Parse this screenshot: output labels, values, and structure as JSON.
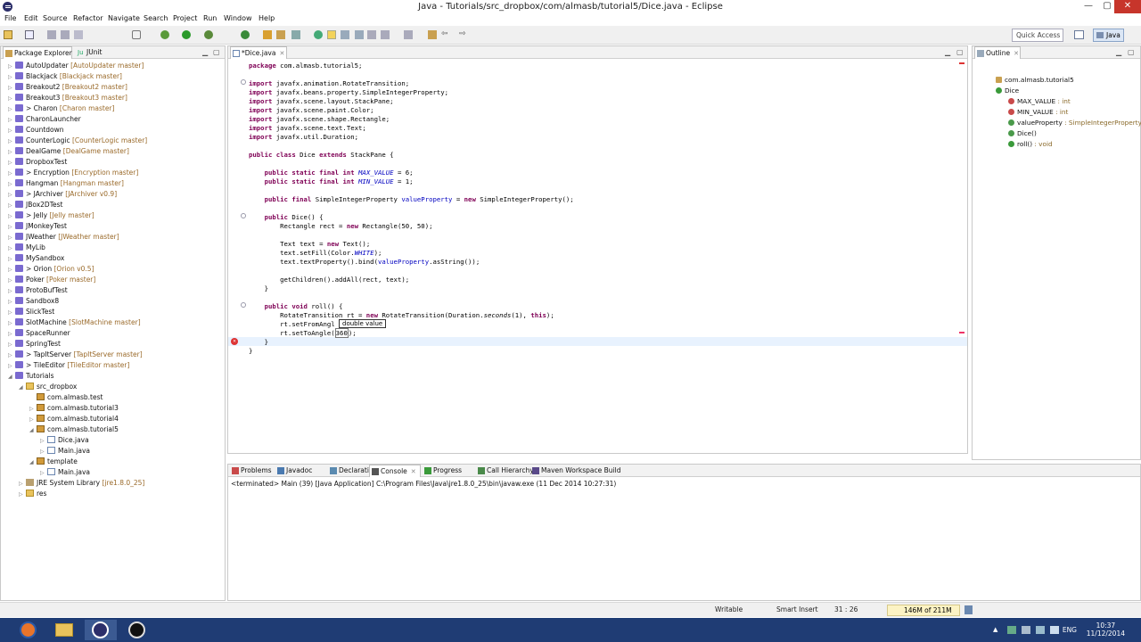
{
  "window": {
    "title": "Java - Tutorials/src_dropbox/com/almasb/tutorial5/Dice.java - Eclipse",
    "min": "—",
    "max": "▢",
    "close": "✕"
  },
  "menu": [
    "File",
    "Edit",
    "Source",
    "Refactor",
    "Navigate",
    "Search",
    "Project",
    "Run",
    "Window",
    "Help"
  ],
  "toolbar": {
    "quick_access": "Quick Access",
    "perspective": "Java"
  },
  "package_explorer": {
    "tabs": [
      "Package Explorer",
      "JUnit"
    ],
    "rows": [
      {
        "indent": 0,
        "tw": "▷",
        "icon": "proj",
        "label": "AutoUpdater",
        "git": "[AutoUpdater master]"
      },
      {
        "indent": 0,
        "tw": "▷",
        "icon": "proj",
        "label": "Blackjack",
        "git": "[Blackjack master]"
      },
      {
        "indent": 0,
        "tw": "▷",
        "icon": "proj",
        "label": "Breakout2",
        "git": "[Breakout2 master]"
      },
      {
        "indent": 0,
        "tw": "▷",
        "icon": "proj",
        "label": "Breakout3",
        "git": "[Breakout3 master]"
      },
      {
        "indent": 0,
        "tw": "▷",
        "icon": "proj",
        "label": "> Charon",
        "git": "[Charon master]"
      },
      {
        "indent": 0,
        "tw": "▷",
        "icon": "proj",
        "label": "CharonLauncher",
        "git": ""
      },
      {
        "indent": 0,
        "tw": "▷",
        "icon": "proj",
        "label": "Countdown",
        "git": ""
      },
      {
        "indent": 0,
        "tw": "▷",
        "icon": "proj",
        "label": "CounterLogic",
        "git": "[CounterLogic master]"
      },
      {
        "indent": 0,
        "tw": "▷",
        "icon": "proj",
        "label": "DealGame",
        "git": "[DealGame master]"
      },
      {
        "indent": 0,
        "tw": "▷",
        "icon": "proj",
        "label": "DropboxTest",
        "git": ""
      },
      {
        "indent": 0,
        "tw": "▷",
        "icon": "proj",
        "label": "> Encryption",
        "git": "[Encryption master]"
      },
      {
        "indent": 0,
        "tw": "▷",
        "icon": "proj",
        "label": "Hangman",
        "git": "[Hangman master]"
      },
      {
        "indent": 0,
        "tw": "▷",
        "icon": "proj",
        "label": "> JArchiver",
        "git": "[JArchiver v0.9]"
      },
      {
        "indent": 0,
        "tw": "▷",
        "icon": "proj",
        "label": "JBox2DTest",
        "git": ""
      },
      {
        "indent": 0,
        "tw": "▷",
        "icon": "proj",
        "label": "> Jelly",
        "git": "[Jelly master]"
      },
      {
        "indent": 0,
        "tw": "▷",
        "icon": "proj",
        "label": "JMonkeyTest",
        "git": ""
      },
      {
        "indent": 0,
        "tw": "▷",
        "icon": "proj",
        "label": "JWeather",
        "git": "[JWeather master]"
      },
      {
        "indent": 0,
        "tw": "▷",
        "icon": "proj",
        "label": "MyLib",
        "git": ""
      },
      {
        "indent": 0,
        "tw": "▷",
        "icon": "proj",
        "label": "MySandbox",
        "git": ""
      },
      {
        "indent": 0,
        "tw": "▷",
        "icon": "proj",
        "label": "> Orion",
        "git": "[Orion v0.5]"
      },
      {
        "indent": 0,
        "tw": "▷",
        "icon": "proj",
        "label": "Poker",
        "git": "[Poker master]"
      },
      {
        "indent": 0,
        "tw": "▷",
        "icon": "proj",
        "label": "ProtoBufTest",
        "git": ""
      },
      {
        "indent": 0,
        "tw": "▷",
        "icon": "proj",
        "label": "Sandbox8",
        "git": ""
      },
      {
        "indent": 0,
        "tw": "▷",
        "icon": "proj",
        "label": "SlickTest",
        "git": ""
      },
      {
        "indent": 0,
        "tw": "▷",
        "icon": "proj",
        "label": "SlotMachine",
        "git": "[SlotMachine master]"
      },
      {
        "indent": 0,
        "tw": "▷",
        "icon": "proj",
        "label": "SpaceRunner",
        "git": ""
      },
      {
        "indent": 0,
        "tw": "▷",
        "icon": "proj",
        "label": "SpringTest",
        "git": ""
      },
      {
        "indent": 0,
        "tw": "▷",
        "icon": "proj",
        "label": "> TapItServer",
        "git": "[TapItServer master]"
      },
      {
        "indent": 0,
        "tw": "▷",
        "icon": "proj",
        "label": "> TileEditor",
        "git": "[TileEditor master]"
      },
      {
        "indent": 0,
        "tw": "◢",
        "icon": "proj",
        "label": "Tutorials",
        "git": ""
      },
      {
        "indent": 1,
        "tw": "◢",
        "icon": "folder",
        "label": "src_dropbox",
        "git": ""
      },
      {
        "indent": 2,
        "tw": "",
        "icon": "pkg",
        "label": "com.almasb.test",
        "git": ""
      },
      {
        "indent": 2,
        "tw": "▷",
        "icon": "pkg",
        "label": "com.almasb.tutorial3",
        "git": ""
      },
      {
        "indent": 2,
        "tw": "▷",
        "icon": "pkg",
        "label": "com.almasb.tutorial4",
        "git": ""
      },
      {
        "indent": 2,
        "tw": "◢",
        "icon": "pkg",
        "label": "com.almasb.tutorial5",
        "git": ""
      },
      {
        "indent": 3,
        "tw": "▷",
        "icon": "file",
        "label": "Dice.java",
        "git": ""
      },
      {
        "indent": 3,
        "tw": "▷",
        "icon": "file",
        "label": "Main.java",
        "git": ""
      },
      {
        "indent": 2,
        "tw": "◢",
        "icon": "pkg",
        "label": "template",
        "git": ""
      },
      {
        "indent": 3,
        "tw": "▷",
        "icon": "file",
        "label": "Main.java",
        "git": ""
      },
      {
        "indent": 1,
        "tw": "▷",
        "icon": "lib",
        "label": "JRE System Library",
        "git": "[jre1.8.0_25]"
      },
      {
        "indent": 1,
        "tw": "▷",
        "icon": "folder",
        "label": "res",
        "git": ""
      }
    ]
  },
  "editor": {
    "tab": "*Dice.java",
    "tooltip": "double value"
  },
  "outline": {
    "tab": "Outline",
    "rows": [
      {
        "indent": 0,
        "label": "com.almasb.tutorial5",
        "type": ""
      },
      {
        "indent": 0,
        "label": "Dice",
        "type": ""
      },
      {
        "indent": 1,
        "label": "MAX_VALUE",
        "type": ": int"
      },
      {
        "indent": 1,
        "label": "MIN_VALUE",
        "type": ": int"
      },
      {
        "indent": 1,
        "label": "valueProperty",
        "type": ": SimpleIntegerProperty"
      },
      {
        "indent": 1,
        "label": "Dice()",
        "type": ""
      },
      {
        "indent": 1,
        "label": "roll()",
        "type": ": void"
      }
    ]
  },
  "bottom": {
    "tabs": [
      "Problems",
      "Javadoc",
      "Declaration",
      "Console",
      "Progress",
      "Call Hierarchy",
      "Maven Workspace Build"
    ],
    "console_line": "<terminated> Main (39) [Java Application] C:\\Program Files\\Java\\jre1.8.0_25\\bin\\javaw.exe (11 Dec 2014 10:27:31)"
  },
  "status": {
    "writable": "Writable",
    "insert": "Smart Insert",
    "position": "31 : 26",
    "heap": "146M of 211M"
  },
  "taskbar": {
    "lang": "ENG",
    "time": "10:37",
    "date": "11/12/2014"
  }
}
